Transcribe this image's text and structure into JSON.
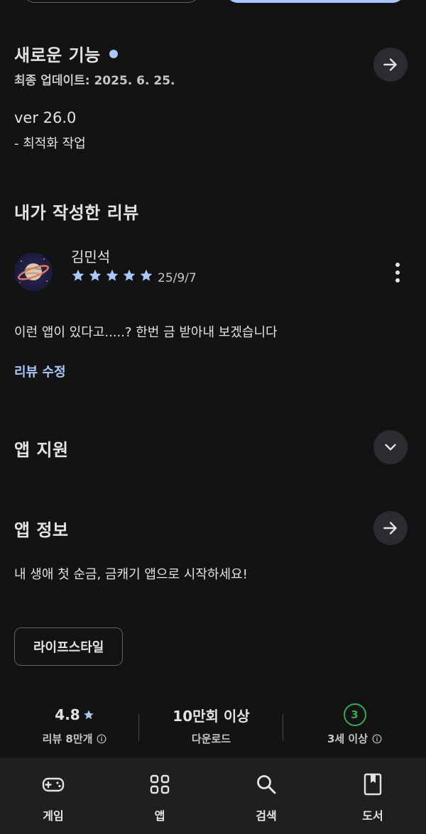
{
  "whats_new": {
    "title": "새로운 기능",
    "updated": "최종 업데이트: 2025. 6. 25.",
    "version": "ver 26.0",
    "notes": "- 최적화 작업"
  },
  "my_review": {
    "title": "내가 작성한 리뷰",
    "reviewer": "김민석",
    "rating": 5,
    "date": "25/9/7",
    "text": "이런 앱이 있다고.....? 한번 금 받아내 보겠습니다",
    "edit_label": "리뷰 수정"
  },
  "app_support": {
    "title": "앱 지원"
  },
  "app_info": {
    "title": "앱 정보",
    "description": "내 생애 첫 순금, 금캐기 앱으로 시작하세요!",
    "category_chip": "라이프스타일"
  },
  "stats": {
    "rating": "4.8",
    "reviews": "리뷰 8만개",
    "downloads": "10만회 이상",
    "downloads_label": "다운로드",
    "age": "3",
    "age_label": "3세 이상"
  },
  "bottom_nav": {
    "games": "게임",
    "apps": "앱",
    "search": "검색",
    "books": "도서"
  },
  "colors": {
    "background": "#131313",
    "accent": "#a8c7fa",
    "age_green": "#34a853"
  }
}
